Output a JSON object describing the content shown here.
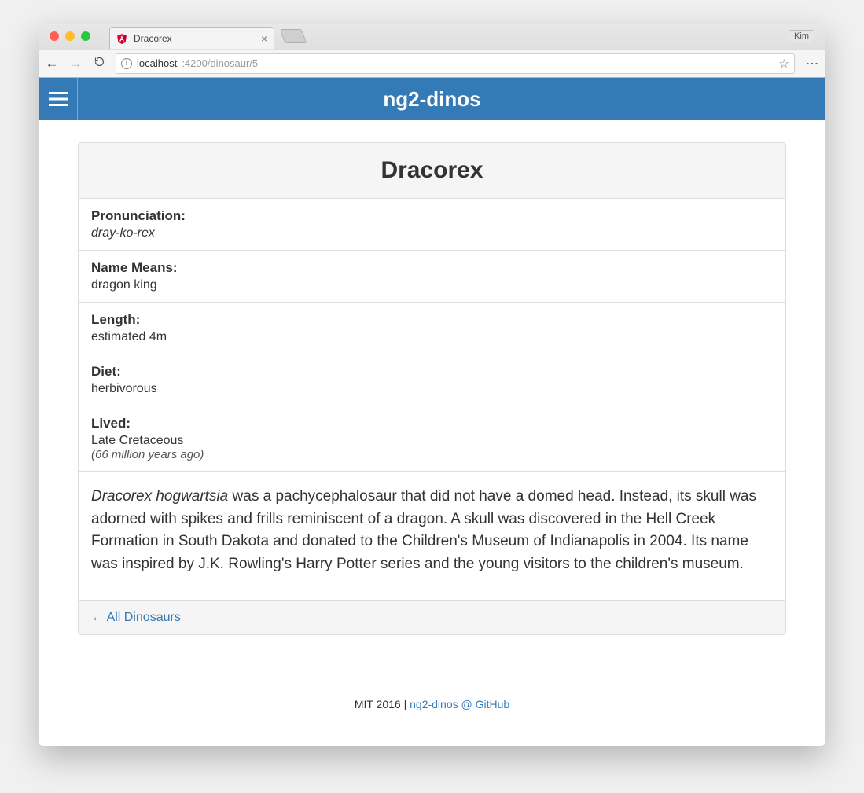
{
  "browser": {
    "tab_title": "Dracorex",
    "profile": "Kim",
    "url_host": "localhost",
    "url_path": ":4200/dinosaur/5"
  },
  "header": {
    "title": "ng2-dinos"
  },
  "dino": {
    "name": "Dracorex",
    "labels": {
      "pronunciation": "Pronunciation:",
      "name_means": "Name Means:",
      "length": "Length:",
      "diet": "Diet:",
      "lived": "Lived:"
    },
    "pronunciation": "dray-ko-rex",
    "name_means": "dragon king",
    "length": "estimated 4m",
    "diet": "herbivorous",
    "lived_period": "Late Cretaceous",
    "lived_years": "(66 million years ago)",
    "desc_latin": "Dracorex hogwartsia",
    "desc_rest": " was a pachycephalosaur that did not have a domed head. Instead, its skull was adorned with spikes and frills reminiscent of a dragon. A skull was discovered in the Hell Creek Formation in South Dakota and donated to the Children's Museum of Indianapolis in 2004. Its name was inspired by J.K. Rowling's Harry Potter series and the young visitors to the children's museum."
  },
  "nav": {
    "back_link": "← All Dinosaurs"
  },
  "footer": {
    "license": "MIT 2016 | ",
    "link": "ng2-dinos @ GitHub"
  }
}
